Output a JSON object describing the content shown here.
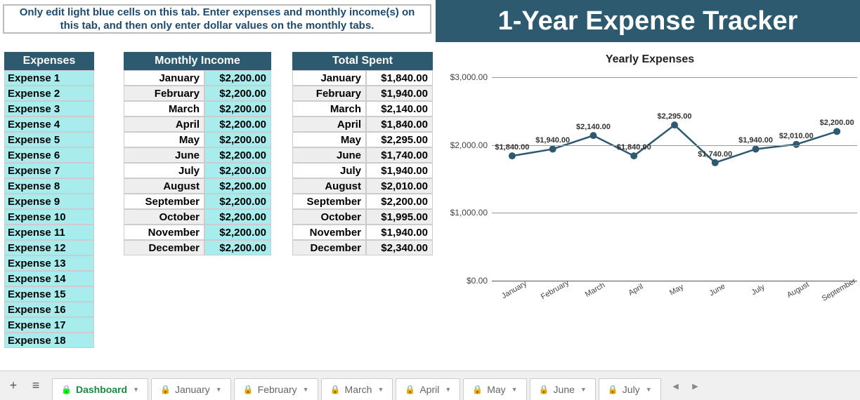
{
  "instructions": "Only edit light blue cells on this tab. Enter expenses and monthly income(s) on this tab, and then only enter dollar values on the monthly tabs.",
  "header_title": "1-Year Expense Tracker",
  "expenses_header": "Expenses",
  "income_header": "Monthly Income",
  "spent_header": "Total Spent",
  "expenses": [
    "Expense 1",
    "Expense 2",
    "Expense 3",
    "Expense 4",
    "Expense 5",
    "Expense 6",
    "Expense 7",
    "Expense 8",
    "Expense 9",
    "Expense 10",
    "Expense 11",
    "Expense 12",
    "Expense 13",
    "Expense 14",
    "Expense 15",
    "Expense 16",
    "Expense 17",
    "Expense 18"
  ],
  "months": [
    "January",
    "February",
    "March",
    "April",
    "May",
    "June",
    "July",
    "August",
    "September",
    "October",
    "November",
    "December"
  ],
  "income_values": [
    "$2,200.00",
    "$2,200.00",
    "$2,200.00",
    "$2,200.00",
    "$2,200.00",
    "$2,200.00",
    "$2,200.00",
    "$2,200.00",
    "$2,200.00",
    "$2,200.00",
    "$2,200.00",
    "$2,200.00"
  ],
  "spent_values": [
    "$1,840.00",
    "$1,940.00",
    "$2,140.00",
    "$1,840.00",
    "$2,295.00",
    "$1,740.00",
    "$1,940.00",
    "$2,010.00",
    "$2,200.00",
    "$1,995.00",
    "$1,940.00",
    "$2,340.00"
  ],
  "chart_data": {
    "type": "line",
    "title": "Yearly Expenses",
    "xlabel": "",
    "ylabel": "",
    "ylim": [
      0,
      3000
    ],
    "yticks": [
      "$0.00",
      "$1,000.00",
      "$2,000.00",
      "$3,000.00"
    ],
    "categories": [
      "January",
      "February",
      "March",
      "April",
      "May",
      "June",
      "July",
      "August",
      "September"
    ],
    "values": [
      1840,
      1940,
      2140,
      1840,
      2295,
      1740,
      1940,
      2010,
      2200
    ],
    "value_labels": [
      "$1,840.00",
      "$1,940.00",
      "$2,140.00",
      "$1,840.00",
      "$2,295.00",
      "$1,740.00",
      "$1,940.00",
      "$2,010.00",
      "$2,200.00"
    ],
    "accent": "#2d5a6e"
  },
  "tabs": [
    {
      "label": "Dashboard",
      "active": true
    },
    {
      "label": "January",
      "active": false
    },
    {
      "label": "February",
      "active": false
    },
    {
      "label": "March",
      "active": false
    },
    {
      "label": "April",
      "active": false
    },
    {
      "label": "May",
      "active": false
    },
    {
      "label": "June",
      "active": false
    },
    {
      "label": "July",
      "active": false
    }
  ]
}
